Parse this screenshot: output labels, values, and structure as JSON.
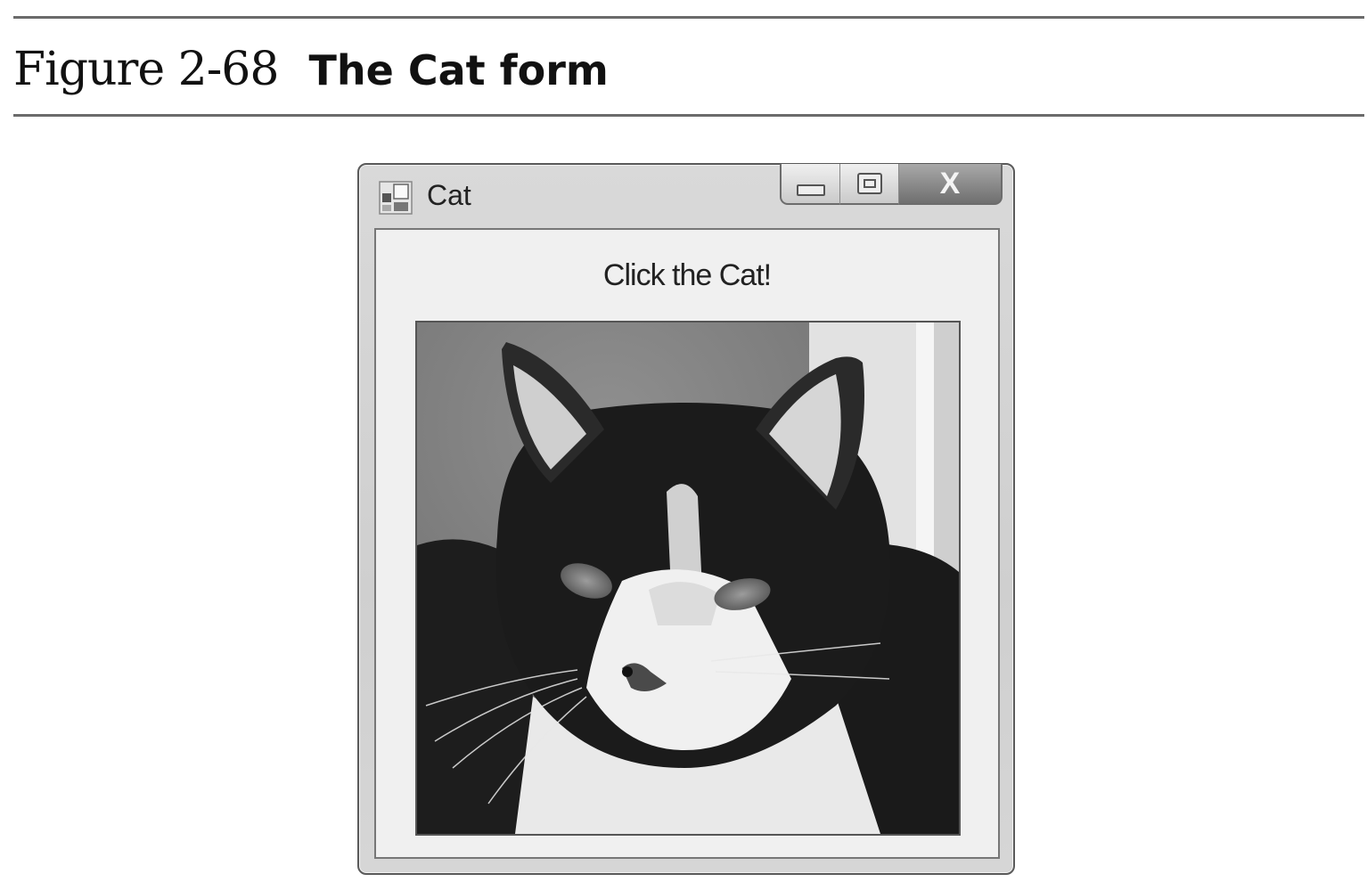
{
  "figure": {
    "label": "Figure 2-68",
    "title": "The Cat form"
  },
  "window": {
    "title": "Cat",
    "icon": "form-icon",
    "caption_buttons": {
      "minimize": "minimize-icon",
      "maximize": "maximize-icon",
      "close_label": "X"
    },
    "label": "Click the Cat!",
    "picture": "cat-photo"
  }
}
